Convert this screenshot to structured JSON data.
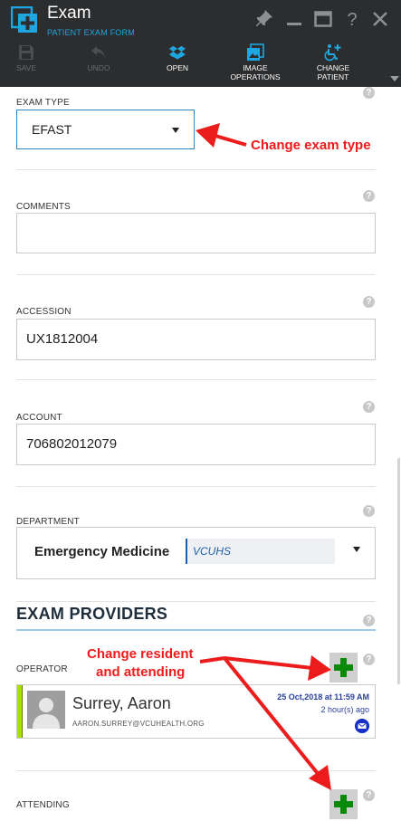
{
  "header": {
    "title": "Exam",
    "subtitle": "PATIENT EXAM FORM",
    "icon": "exam-plus-icon",
    "window_controls": [
      "pin-icon",
      "minimize-icon",
      "maximize-icon",
      "help-icon",
      "close-icon"
    ],
    "toolbar": [
      {
        "label": "SAVE",
        "icon": "save-icon",
        "enabled": false
      },
      {
        "label": "UNDO",
        "icon": "undo-icon",
        "enabled": false
      },
      {
        "label": "OPEN",
        "icon": "dropbox-icon",
        "enabled": true
      },
      {
        "label": "IMAGE",
        "label2": "OPERATIONS",
        "icon": "images-icon",
        "enabled": true
      },
      {
        "label": "CHANGE",
        "label2": "PATIENT",
        "icon": "accessible-plus-icon",
        "enabled": true
      }
    ]
  },
  "form": {
    "exam_type": {
      "label": "EXAM TYPE",
      "value": "EFAST"
    },
    "comments": {
      "label": "COMMENTS",
      "value": ""
    },
    "accession": {
      "label": "ACCESSION",
      "value": "UX1812004"
    },
    "account": {
      "label": "ACCOUNT",
      "value": "706802012079"
    },
    "department": {
      "label": "DEPARTMENT",
      "name": "Emergency Medicine",
      "code": "VCUHS"
    }
  },
  "providers": {
    "section_title": "EXAM PROVIDERS",
    "operator": {
      "label": "OPERATOR",
      "name": "Surrey, Aaron",
      "email": "AARON.SURREY@VCUHEALTH.ORG",
      "date": "25 Oct,2018 at 11:59 AM",
      "ago": "2 hour(s) ago"
    },
    "attending": {
      "label": "ATTENDING"
    }
  },
  "annotations": {
    "exam_type": "Change exam type",
    "providers_line1": "Change resident",
    "providers_line2": "and attending"
  },
  "colors": {
    "header_bg": "#2b2d2f",
    "accent": "#1fa6e0",
    "annotation": "#ec1c1c",
    "add_green": "#0a8a0a",
    "status_bar": "#a8e000"
  }
}
